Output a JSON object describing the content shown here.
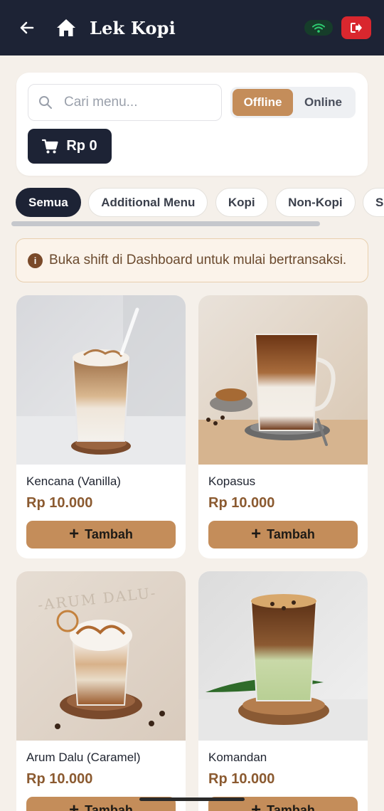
{
  "header": {
    "title": "Lek Kopi",
    "icons": {
      "back": "arrow-left-icon",
      "home": "home-icon",
      "connection": "wifi-icon",
      "logout": "logout-icon"
    }
  },
  "toolbar": {
    "search_placeholder": "Cari menu...",
    "search_value": "",
    "mode_options": [
      "Offline",
      "Online"
    ],
    "mode_selected": "Offline",
    "cart_total": "Rp 0"
  },
  "categories": {
    "items": [
      "Semua",
      "Additional Menu",
      "Kopi",
      "Non-Kopi",
      "So"
    ],
    "selected": "Semua"
  },
  "notice": {
    "message": "Buka shift di Dashboard untuk mulai bertransaksi."
  },
  "products": [
    {
      "name": "Kencana (Vanilla)",
      "price": "Rp 10.000",
      "button": "Tambah"
    },
    {
      "name": "Kopasus",
      "price": "Rp 10.000",
      "button": "Tambah"
    },
    {
      "name": "Arum Dalu (Caramel)",
      "price": "Rp 10.000",
      "button": "Tambah"
    },
    {
      "name": "Komandan",
      "price": "Rp 10.000",
      "button": "Tambah"
    }
  ],
  "colors": {
    "header_bg": "#1d2335",
    "accent": "#c48d5a",
    "price": "#8b5a30",
    "logout": "#d9272e",
    "online_indicator": "#2ecc71"
  }
}
